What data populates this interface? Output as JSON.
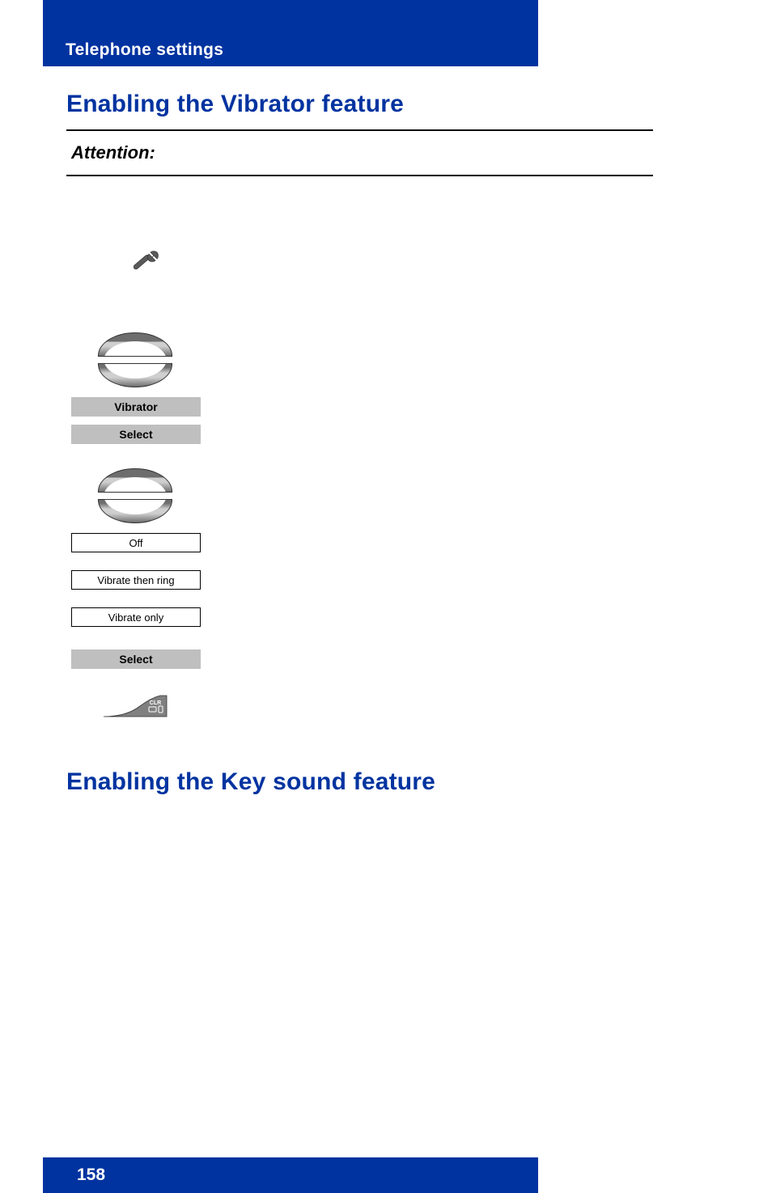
{
  "header": {
    "section": "Telephone settings"
  },
  "headings": {
    "h1_vibrator": "Enabling the Vibrator feature",
    "attention": "Attention:",
    "h1_keysound": "Enabling the Key sound feature"
  },
  "ui": {
    "menu_item_vibrator": "Vibrator",
    "soft_select_1": "Select",
    "option_off": "Off",
    "option_vibrate_then_ring": "Vibrate then ring",
    "option_vibrate_only": "Vibrate only",
    "soft_select_2": "Select",
    "key_clr": "CLR"
  },
  "footer": {
    "page": "158"
  }
}
